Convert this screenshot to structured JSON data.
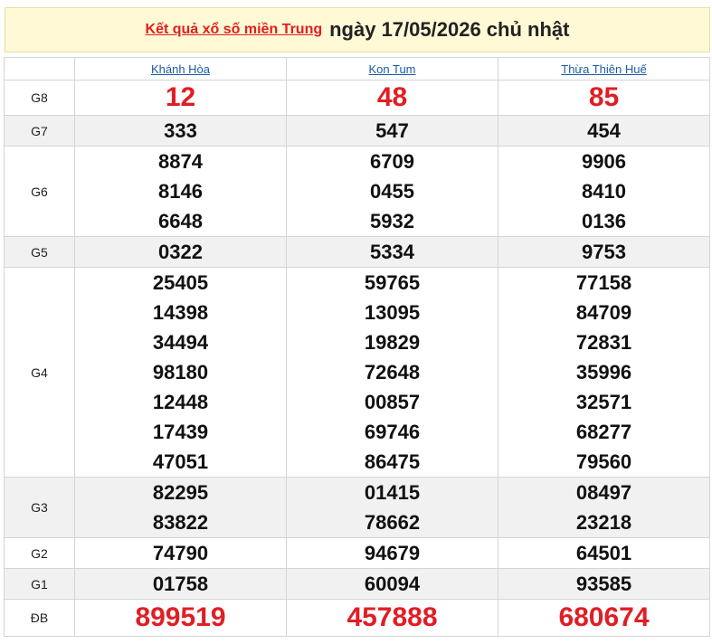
{
  "header": {
    "link_text": "Kết quả xổ số miền Trung",
    "date_text": "ngày 17/05/2026 chủ nhật"
  },
  "provinces": [
    "Khánh Hòa",
    "Kon Tum",
    "Thừa Thiên Huế"
  ],
  "rows": [
    {
      "prize": "G8",
      "style": "big",
      "alt": false,
      "values": [
        [
          "12"
        ],
        [
          "48"
        ],
        [
          "85"
        ]
      ]
    },
    {
      "prize": "G7",
      "style": "",
      "alt": true,
      "values": [
        [
          "333"
        ],
        [
          "547"
        ],
        [
          "454"
        ]
      ]
    },
    {
      "prize": "G6",
      "style": "",
      "alt": false,
      "values": [
        [
          "8874",
          "8146",
          "6648"
        ],
        [
          "6709",
          "0455",
          "5932"
        ],
        [
          "9906",
          "8410",
          "0136"
        ]
      ]
    },
    {
      "prize": "G5",
      "style": "",
      "alt": true,
      "values": [
        [
          "0322"
        ],
        [
          "5334"
        ],
        [
          "9753"
        ]
      ]
    },
    {
      "prize": "G4",
      "style": "",
      "alt": false,
      "values": [
        [
          "25405",
          "14398",
          "34494",
          "98180",
          "12448",
          "17439",
          "47051"
        ],
        [
          "59765",
          "13095",
          "19829",
          "72648",
          "00857",
          "69746",
          "86475"
        ],
        [
          "77158",
          "84709",
          "72831",
          "35996",
          "32571",
          "68277",
          "79560"
        ]
      ]
    },
    {
      "prize": "G3",
      "style": "",
      "alt": true,
      "values": [
        [
          "82295",
          "83822"
        ],
        [
          "01415",
          "78662"
        ],
        [
          "08497",
          "23218"
        ]
      ]
    },
    {
      "prize": "G2",
      "style": "",
      "alt": false,
      "values": [
        [
          "74790"
        ],
        [
          "94679"
        ],
        [
          "64501"
        ]
      ]
    },
    {
      "prize": "G1",
      "style": "",
      "alt": true,
      "values": [
        [
          "01758"
        ],
        [
          "60094"
        ],
        [
          "93585"
        ]
      ]
    },
    {
      "prize": "ĐB",
      "style": "special",
      "alt": false,
      "values": [
        [
          "899519"
        ],
        [
          "457888"
        ],
        [
          "680674"
        ]
      ]
    }
  ]
}
